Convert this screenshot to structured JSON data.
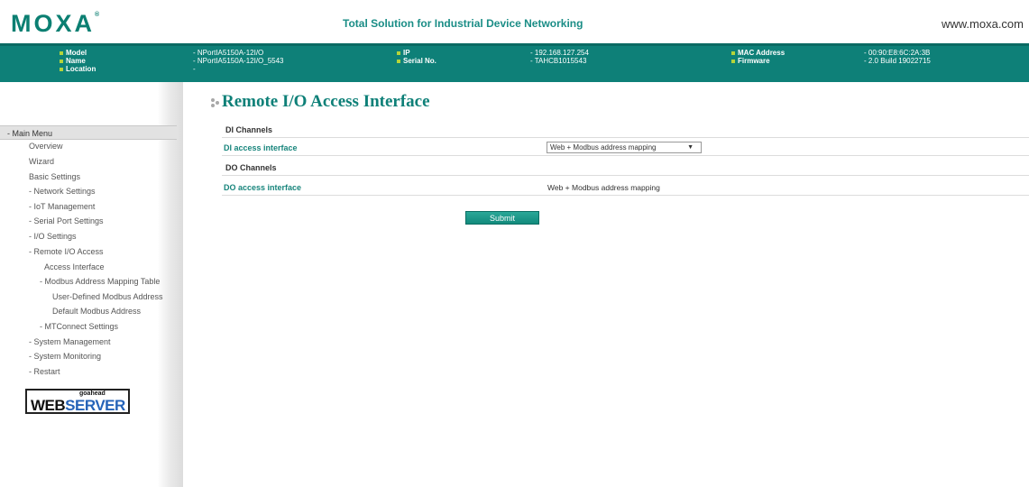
{
  "header": {
    "logo": "MOXA",
    "tagline": "Total Solution for Industrial Device Networking",
    "website": "www.moxa.com"
  },
  "info": {
    "model_label": "Model",
    "model_value": "- NPortIA5150A-12I/O",
    "name_label": "Name",
    "name_value": "- NPortIA5150A-12I/O_5543",
    "location_label": "Location",
    "location_value": "-",
    "ip_label": "IP",
    "ip_value": "- 192.168.127.254",
    "serial_label": "Serial No.",
    "serial_value": "- TAHCB1015543",
    "mac_label": "MAC Address",
    "mac_value": "- 00:90:E8:6C:2A:3B",
    "firmware_label": "Firmware",
    "firmware_value": "- 2.0 Build 19022715"
  },
  "sidebar": {
    "header": "- Main Menu",
    "items": [
      "Overview",
      "Wizard",
      "Basic Settings",
      "- Network Settings",
      "- IoT Management",
      "- Serial Port Settings",
      "- I/O Settings",
      "- Remote I/O Access",
      "Access Interface",
      "- Modbus Address Mapping Table",
      "User-Defined Modbus Address",
      "Default Modbus Address",
      "- MTConnect Settings",
      "- System Management",
      "- System Monitoring",
      "- Restart"
    ],
    "webserver_small": "goahead",
    "webserver_web": "WEB",
    "webserver_server": "SERVER"
  },
  "main": {
    "title": "Remote I/O Access Interface",
    "di_section": "DI Channels",
    "di_label": "DI access interface",
    "di_select_value": "Web + Modbus address mapping",
    "do_section": "DO Channels",
    "do_label": "DO access interface",
    "do_value": "Web + Modbus address mapping",
    "submit": "Submit"
  },
  "colors": {
    "brand": "#0e8078",
    "accent_square": "#b5d43a",
    "link": "#18857c"
  }
}
